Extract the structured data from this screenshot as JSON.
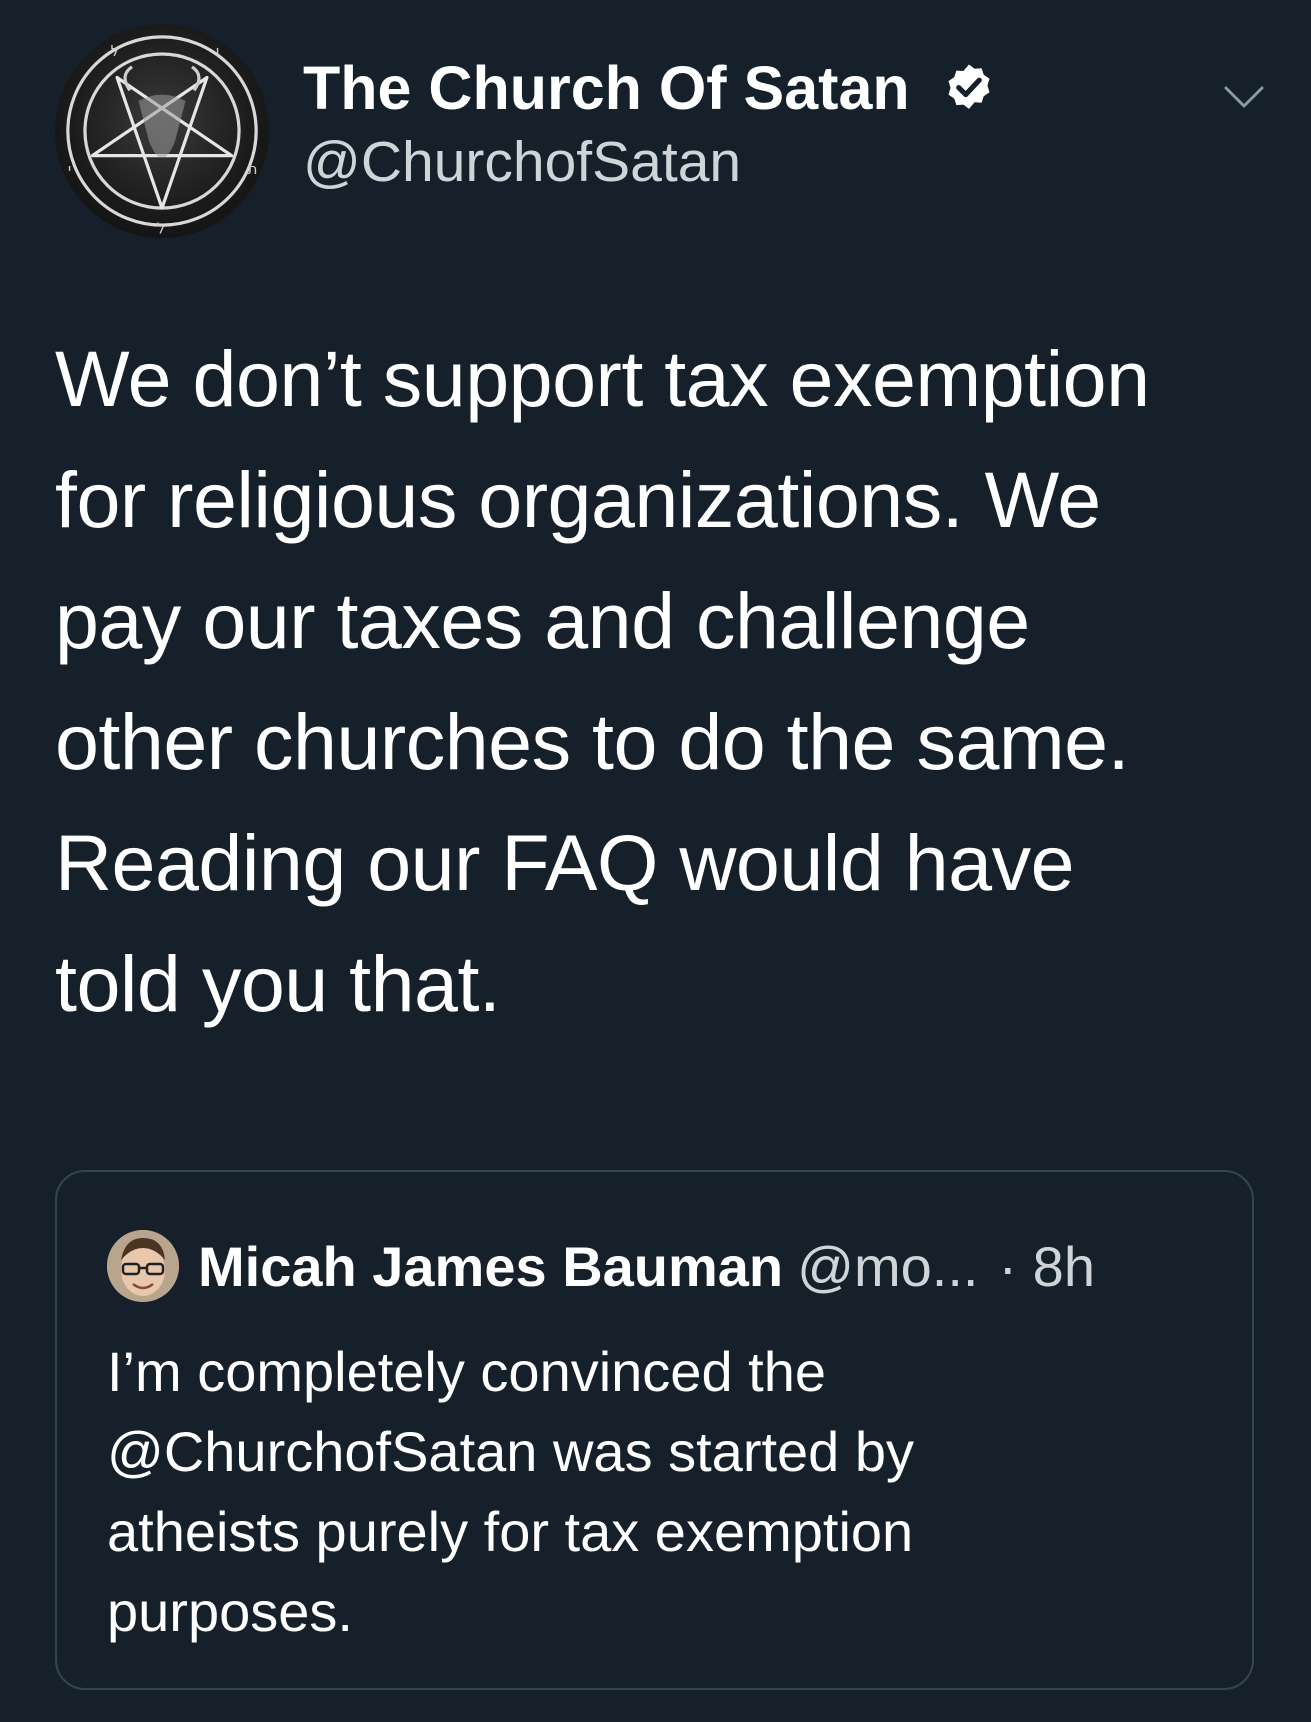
{
  "colors": {
    "background": "#15202b",
    "text": "#ffffff",
    "secondary_text": "#cfd4d9",
    "card_border": "#38444d"
  },
  "tweet": {
    "author": {
      "display_name": "The Church Of Satan",
      "handle": "@ChurchofSatan",
      "verified": true,
      "avatar_icon": "sigil-of-baphomet-icon"
    },
    "menu_icon": "chevron-down-icon",
    "text_lines": [
      "We don’t support tax exemption",
      "for religious organizations. We",
      "pay our taxes and challenge",
      "other churches to do the same.",
      "Reading our FAQ would have",
      "told you that."
    ]
  },
  "quoted_tweet": {
    "author": {
      "display_name": "Micah James Bauman",
      "handle": "@mo...",
      "avatar_icon": "user-photo-icon"
    },
    "time": "· 8h",
    "text_lines": [
      "I’m completely convinced the",
      "@ChurchofSatan was started by",
      "atheists purely for tax exemption",
      "purposes."
    ]
  }
}
